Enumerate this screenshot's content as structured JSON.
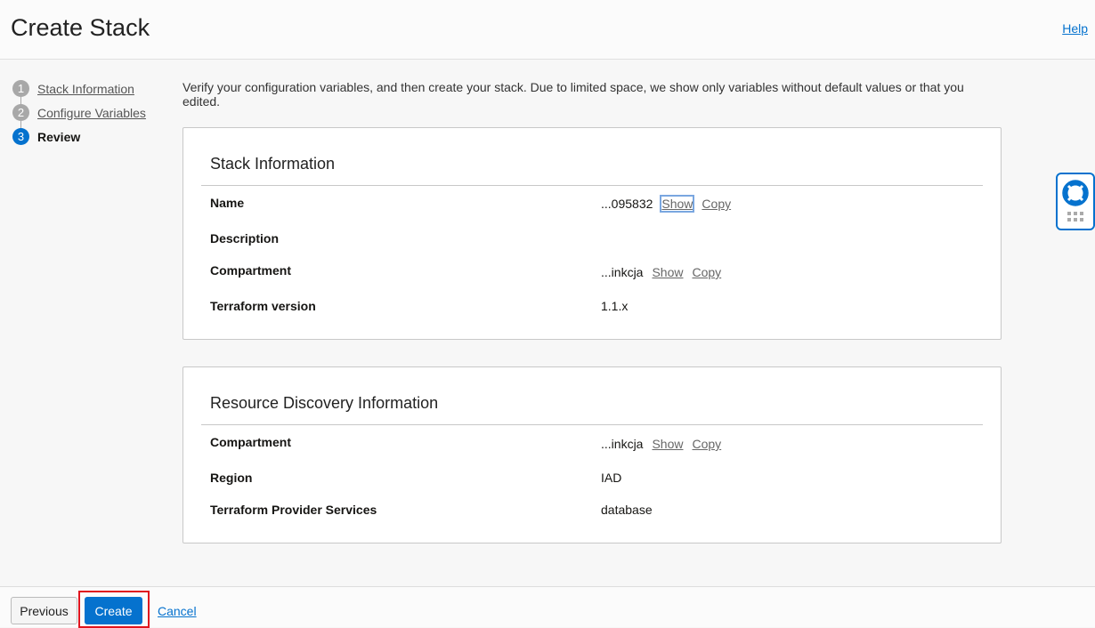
{
  "header": {
    "title": "Create Stack",
    "help": "Help"
  },
  "steps": [
    {
      "num": "1",
      "label": "Stack Information"
    },
    {
      "num": "2",
      "label": "Configure Variables"
    },
    {
      "num": "3",
      "label": "Review"
    }
  ],
  "intro": "Verify your configuration variables, and then create your stack. Due to limited space, we show only variables without default values or that you edited.",
  "stack_info": {
    "title": "Stack Information",
    "rows": [
      {
        "label": "Name",
        "value": "...095832",
        "show": "Show",
        "copy": "Copy"
      },
      {
        "label": "Description",
        "value": ""
      },
      {
        "label": "Compartment",
        "value": "...inkcja",
        "show": "Show",
        "copy": "Copy"
      },
      {
        "label": "Terraform version",
        "value": "1.1.x"
      }
    ]
  },
  "discovery": {
    "title": "Resource Discovery Information",
    "rows": [
      {
        "label": "Compartment",
        "value": "...inkcja",
        "show": "Show",
        "copy": "Copy"
      },
      {
        "label": "Region",
        "value": "IAD"
      },
      {
        "label": "Terraform Provider Services",
        "value": "database"
      }
    ]
  },
  "footer": {
    "previous": "Previous",
    "create": "Create",
    "cancel": "Cancel"
  },
  "colors": {
    "accent": "#0572ce",
    "highlight": "#e0141e"
  },
  "icons": {
    "help_widget": "lifebuoy-icon"
  }
}
